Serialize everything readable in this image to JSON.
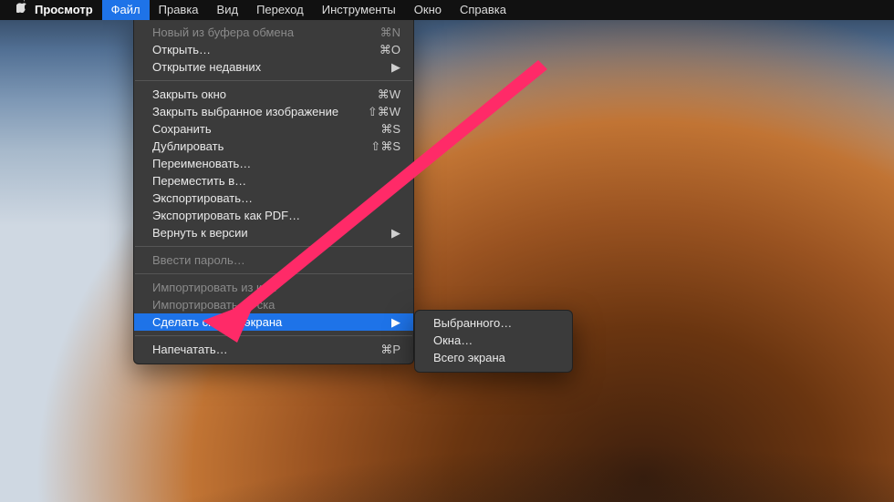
{
  "menubar": {
    "app": "Просмотр",
    "items": [
      "Файл",
      "Правка",
      "Вид",
      "Переход",
      "Инструменты",
      "Окно",
      "Справка"
    ],
    "active_index": 0
  },
  "menu": {
    "groups": [
      [
        {
          "label": "Новый из буфера обмена",
          "shortcut": "⌘N",
          "disabled": true
        },
        {
          "label": "Открыть…",
          "shortcut": "⌘O"
        },
        {
          "label": "Открытие недавних",
          "submenu": true
        }
      ],
      [
        {
          "label": "Закрыть окно",
          "shortcut": "⌘W"
        },
        {
          "label": "Закрыть выбранное изображение",
          "shortcut": "⇧⌘W"
        },
        {
          "label": "Сохранить",
          "shortcut": "⌘S"
        },
        {
          "label": "Дублировать",
          "shortcut": "⇧⌘S"
        },
        {
          "label": "Переименовать…"
        },
        {
          "label": "Переместить в…"
        },
        {
          "label": "Экспортировать…"
        },
        {
          "label": "Экспортировать как PDF…"
        },
        {
          "label": "Вернуть к версии",
          "submenu": true
        }
      ],
      [
        {
          "label": "Ввести пароль…",
          "disabled": true
        }
      ],
      [
        {
          "label": "Импортировать из кам",
          "disabled": true
        },
        {
          "label": "Импортировать со ска",
          "disabled": true
        },
        {
          "label": "Сделать снимок экрана",
          "submenu": true,
          "highlight": true
        }
      ],
      [
        {
          "label": "Напечатать…",
          "shortcut": "⌘P"
        }
      ]
    ]
  },
  "submenu": {
    "items": [
      {
        "label": "Выбранного…"
      },
      {
        "label": "Окна…"
      },
      {
        "label": "Всего экрана"
      }
    ]
  }
}
